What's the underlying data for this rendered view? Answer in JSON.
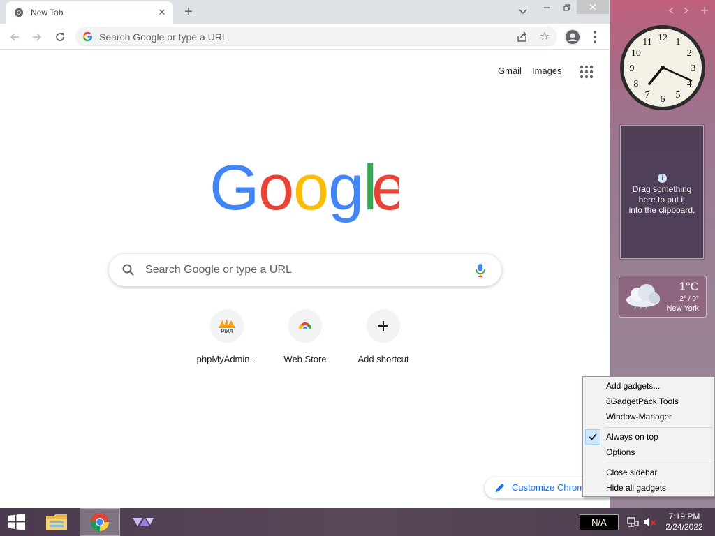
{
  "browser": {
    "tab": {
      "title": "New Tab",
      "close_glyph": "✕"
    },
    "new_tab_glyph": "+",
    "omnibox": {
      "placeholder": "Search Google or type a URL"
    },
    "header_links": {
      "gmail": "Gmail",
      "images": "Images"
    },
    "search": {
      "placeholder": "Search Google or type a URL"
    },
    "shortcuts": [
      {
        "label": "phpMyAdmin...",
        "icon": "pma-icon"
      },
      {
        "label": "Web Store",
        "icon": "web-store-icon"
      },
      {
        "label": "Add shortcut",
        "icon": "plus-icon"
      }
    ],
    "customize_label": "Customize Chrome",
    "logo_letters": [
      "G",
      "o",
      "o",
      "g",
      "l",
      "e"
    ],
    "colors": {
      "blue": "#4285f4",
      "red": "#ea4335",
      "yellow": "#fbbc05",
      "green": "#34a853",
      "link": "#1a73e8"
    }
  },
  "gadgets": {
    "clock": {
      "hour": 7,
      "minute": 19,
      "numerals": [
        "12",
        "1",
        "2",
        "3",
        "4",
        "5",
        "6",
        "7",
        "8",
        "9",
        "10",
        "11"
      ]
    },
    "clipboard": {
      "info_glyph": "i",
      "text": [
        "Drag something",
        "here to put it",
        "into the clipboard."
      ]
    },
    "weather": {
      "temp": "1°C",
      "range": "2° / 0°",
      "city": "New York"
    }
  },
  "context_menu": {
    "items": [
      {
        "label": "Add gadgets..."
      },
      {
        "label": "8GadgetPack Tools"
      },
      {
        "label": "Window-Manager"
      },
      {
        "label": "Always on top",
        "checked": true
      },
      {
        "label": "Options"
      },
      {
        "label": "Close sidebar"
      },
      {
        "label": "Hide all gadgets"
      }
    ]
  },
  "taskbar": {
    "indicator": "N/A",
    "time": "7:19 PM",
    "date": "2/24/2022"
  }
}
